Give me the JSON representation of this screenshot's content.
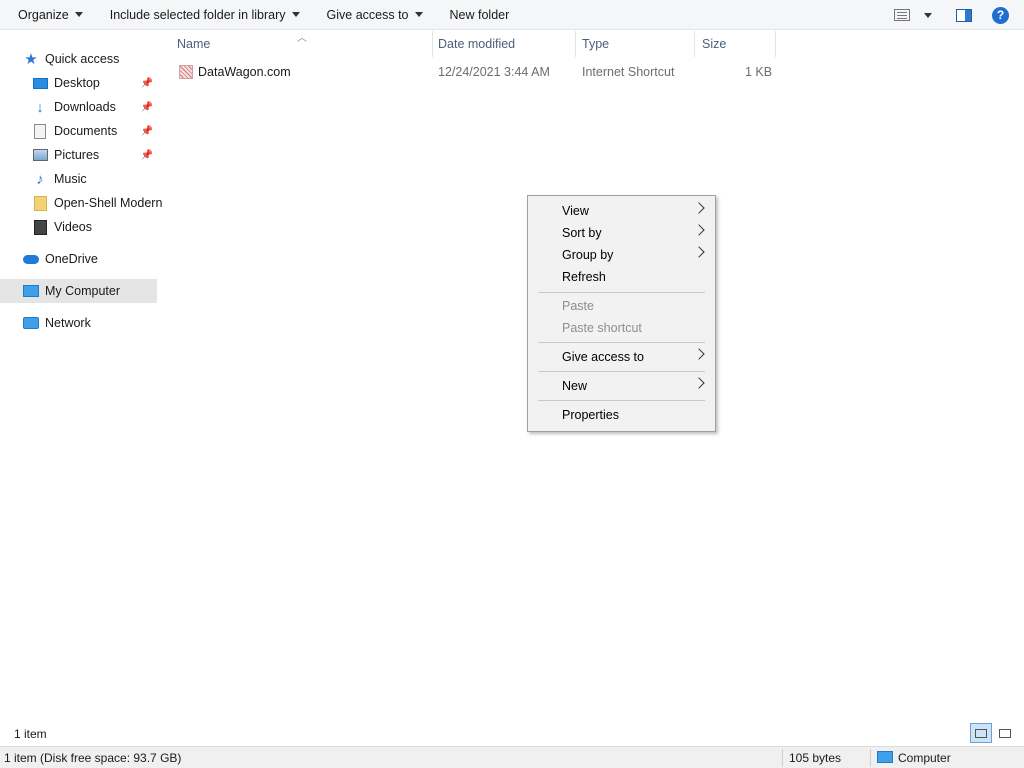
{
  "toolbar": {
    "organize": "Organize",
    "include_library": "Include selected folder in library",
    "give_access": "Give access to",
    "new_folder": "New folder",
    "help": "?"
  },
  "nav": {
    "quick_access": "Quick access",
    "items": [
      {
        "label": "Desktop",
        "icon": "desktop-icon",
        "pinned": true
      },
      {
        "label": "Downloads",
        "icon": "download-arrow-icon",
        "pinned": true
      },
      {
        "label": "Documents",
        "icon": "document-icon",
        "pinned": true
      },
      {
        "label": "Pictures",
        "icon": "pictures-icon",
        "pinned": true
      },
      {
        "label": "Music",
        "icon": "music-note-icon",
        "pinned": false
      },
      {
        "label": "Open-Shell Modern",
        "icon": "folder-icon",
        "pinned": false
      },
      {
        "label": "Videos",
        "icon": "video-icon",
        "pinned": false
      }
    ],
    "onedrive": "OneDrive",
    "my_computer": "My Computer",
    "network": "Network"
  },
  "columns": {
    "name": "Name",
    "date_modified": "Date modified",
    "type": "Type",
    "size": "Size"
  },
  "files": [
    {
      "name": "DataWagon.com",
      "date": "12/24/2021 3:44 AM",
      "type": "Internet Shortcut",
      "size": "1 KB"
    }
  ],
  "context_menu": {
    "view": "View",
    "sort_by": "Sort by",
    "group_by": "Group by",
    "refresh": "Refresh",
    "paste": "Paste",
    "paste_shortcut": "Paste shortcut",
    "give_access": "Give access to",
    "new": "New",
    "properties": "Properties"
  },
  "status": {
    "item_count": "1 item",
    "disk_info": "1 item (Disk free space: 93.7 GB)",
    "bytes": "105 bytes",
    "location": "Computer"
  }
}
